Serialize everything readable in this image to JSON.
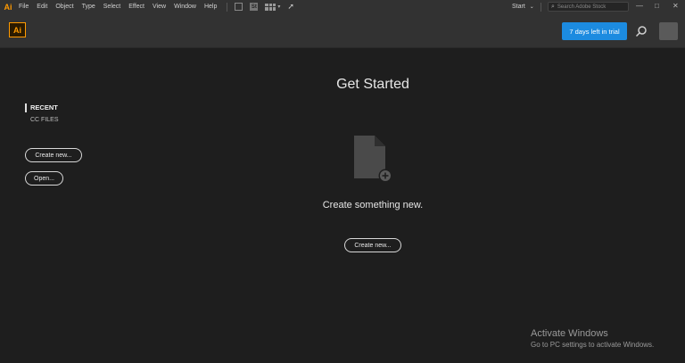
{
  "app": {
    "mini_logo": "Ai",
    "logo": "Ai"
  },
  "menu": [
    "File",
    "Edit",
    "Object",
    "Type",
    "Select",
    "Effect",
    "View",
    "Window",
    "Help"
  ],
  "toolbar": {
    "bridge_icon": "bridge-icon",
    "stock_icon_label": "St",
    "workspace": "Start",
    "stock_search_placeholder": "Search Adobe Stock"
  },
  "window_controls": {
    "minimize": "—",
    "maximize": "□",
    "close": "✕"
  },
  "header": {
    "trial_label": "7 days left in trial"
  },
  "sidebar": {
    "recent_label": "RECENT",
    "cc_files_label": "CC FILES",
    "create_new_label": "Create new...",
    "open_label": "Open..."
  },
  "main": {
    "title": "Get Started",
    "tagline": "Create something new.",
    "create_new_label": "Create new..."
  },
  "watermark": {
    "line1": "Activate Windows",
    "line2": "Go to PC settings to activate Windows."
  },
  "colors": {
    "accent": "#1c8be0",
    "brand": "#ff9a00",
    "background": "#1e1e1e",
    "chrome": "#323232"
  }
}
